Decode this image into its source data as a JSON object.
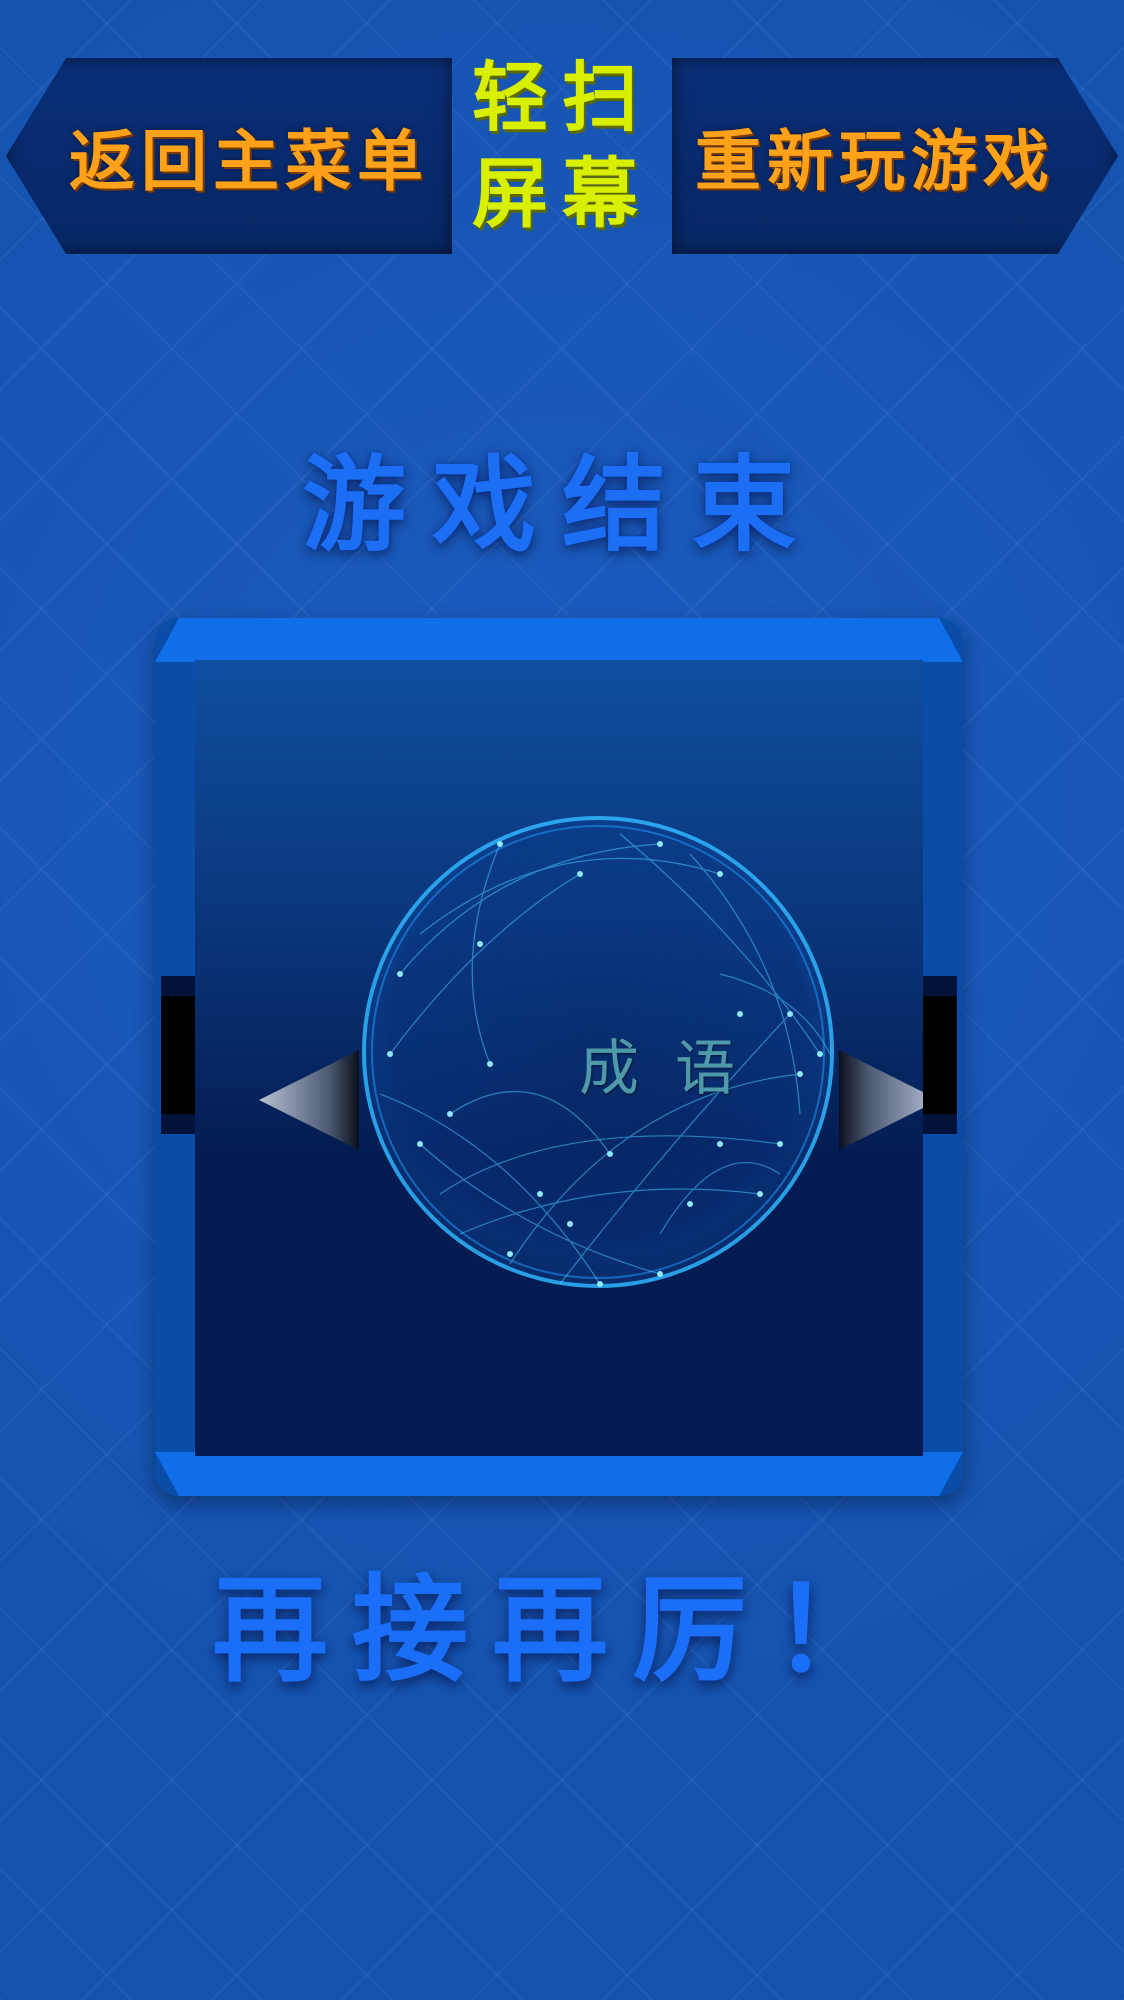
{
  "top_bar": {
    "menu_button_label": "返回主菜单",
    "hint_line1": "轻扫",
    "hint_line2": "屏幕",
    "replay_button_label": "重新玩游戏"
  },
  "status": {
    "title": "游戏结束"
  },
  "card": {
    "label": "成语",
    "left_arrow_icon": "left-arrow-icon",
    "right_arrow_icon": "right-arrow-icon",
    "globe_icon": "network-globe-icon"
  },
  "footer": {
    "message": "再接再厉！"
  },
  "colors": {
    "background": "#1553b0",
    "button_text": "#ffa21a",
    "hint_text": "#d8f000",
    "title_text": "#1c6ef5",
    "card_frame": "#0f6ee8"
  }
}
